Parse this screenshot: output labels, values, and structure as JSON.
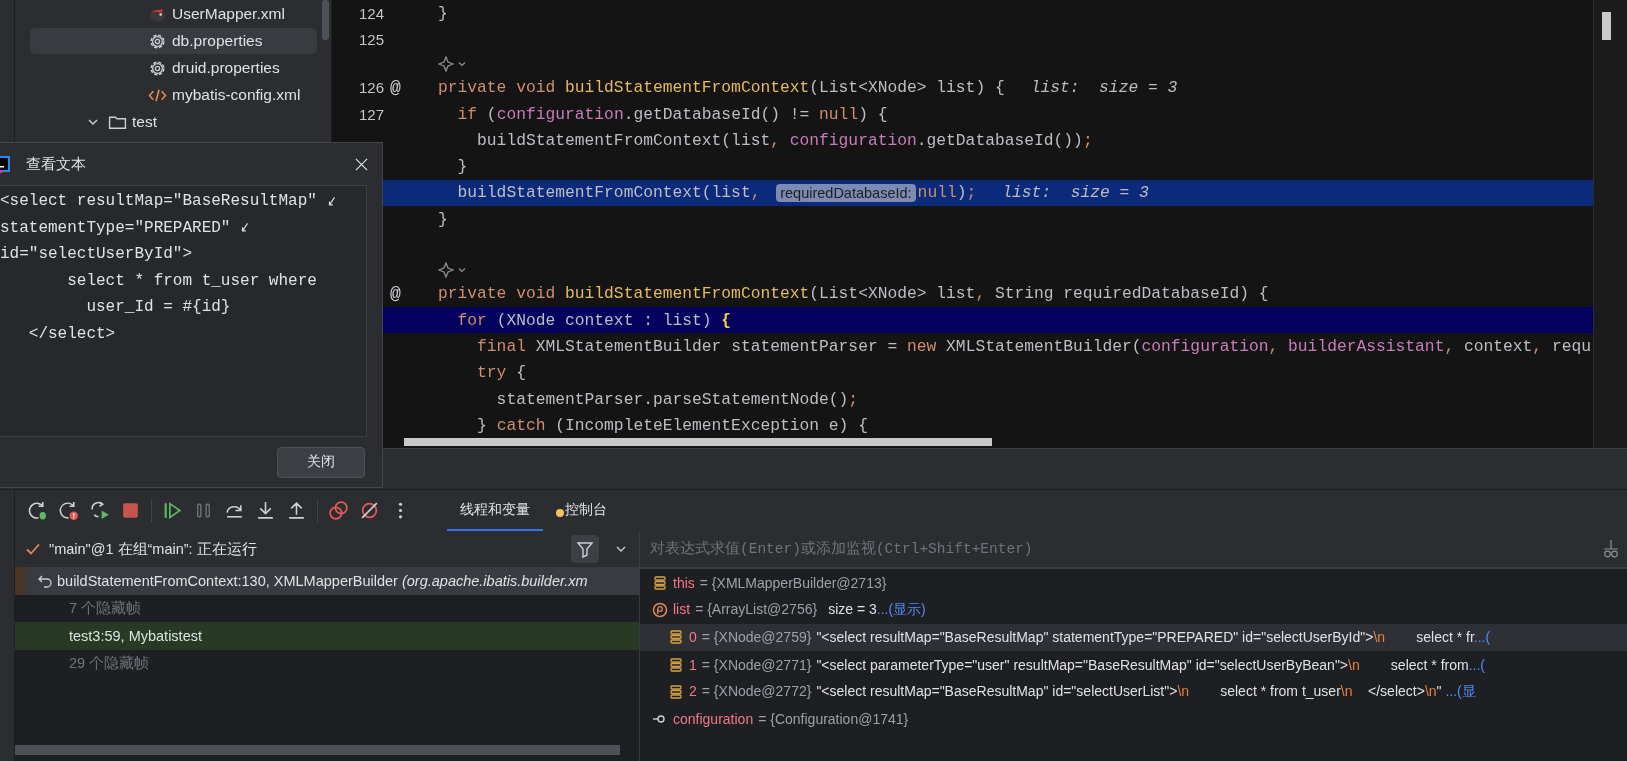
{
  "project_tree": {
    "files": [
      {
        "label": "UserMapper.xml",
        "kind": "mapper",
        "selected": false
      },
      {
        "label": "db.properties",
        "kind": "properties",
        "selected": true
      },
      {
        "label": "druid.properties",
        "kind": "properties",
        "selected": false
      },
      {
        "label": "mybatis-config.xml",
        "kind": "xml",
        "selected": false
      }
    ],
    "folders": [
      {
        "label": "test",
        "expanded": true,
        "selected": false
      }
    ]
  },
  "editor": {
    "lines": [
      {
        "kind": "code",
        "number": "124",
        "tokens": [
          {
            "kind": "plain",
            "text": "}"
          }
        ]
      },
      {
        "kind": "code",
        "number": "125"
      },
      {
        "kind": "inlay"
      },
      {
        "kind": "code",
        "number": "126",
        "gutter": "@",
        "tokens": [
          {
            "kind": "keyword",
            "text": "private void "
          },
          {
            "kind": "method",
            "text": "buildStatementFromContext"
          },
          {
            "kind": "plain",
            "text": "(List<XNode> list) {"
          },
          {
            "kind": "value",
            "text": "list:  size = 3"
          }
        ]
      },
      {
        "kind": "code",
        "number": "127",
        "tokens": [
          {
            "kind": "keyword",
            "text": "  if "
          },
          {
            "kind": "plain",
            "text": "("
          },
          {
            "kind": "field",
            "text": "configuration"
          },
          {
            "kind": "plain",
            "text": ".getDatabaseId() != "
          },
          {
            "kind": "keyword",
            "text": "null"
          },
          {
            "kind": "plain",
            "text": ") {"
          }
        ]
      },
      {
        "kind": "code",
        "tokens": [
          {
            "kind": "plain",
            "text": "    buildStatementFromContext(list"
          },
          {
            "kind": "punct",
            "text": ", "
          },
          {
            "kind": "field",
            "text": "configuration"
          },
          {
            "kind": "plain",
            "text": ".getDatabaseId())"
          },
          {
            "kind": "punct",
            "text": ";"
          }
        ]
      },
      {
        "kind": "code",
        "tokens": [
          {
            "kind": "plain",
            "text": "  }"
          }
        ]
      },
      {
        "kind": "frame_line",
        "tokens": [
          {
            "kind": "plain",
            "text": "  buildStatementFromContext(list"
          },
          {
            "kind": "punct",
            "text": ", "
          },
          {
            "kind": "param_hint",
            "text": "requiredDatabaseId:"
          },
          {
            "kind": "keyword",
            "text": "null"
          },
          {
            "kind": "plain",
            "text": ")"
          },
          {
            "kind": "punct",
            "text": ";"
          },
          {
            "kind": "value",
            "text": "list:  size = 3"
          }
        ]
      },
      {
        "kind": "code",
        "tokens": [
          {
            "kind": "plain",
            "text": "}"
          }
        ]
      },
      {
        "kind": "code"
      },
      {
        "kind": "inlay"
      },
      {
        "kind": "code",
        "gutter": "@",
        "tokens": [
          {
            "kind": "keyword",
            "text": "private void "
          },
          {
            "kind": "method",
            "text": "buildStatementFromContext"
          },
          {
            "kind": "plain",
            "text": "(List<XNode> list"
          },
          {
            "kind": "punct",
            "text": ", "
          },
          {
            "kind": "plain",
            "text": "String requiredDatabaseId) {"
          }
        ]
      },
      {
        "kind": "current_line",
        "tokens": [
          {
            "kind": "keyword",
            "text": "  for "
          },
          {
            "kind": "plain",
            "text": "(XNode context : list) "
          },
          {
            "kind": "match",
            "text": "{"
          }
        ]
      },
      {
        "kind": "code",
        "tokens": [
          {
            "kind": "keyword",
            "text": "    final "
          },
          {
            "kind": "plain",
            "text": "XMLStatementBuilder statementParser = "
          },
          {
            "kind": "keyword",
            "text": "new "
          },
          {
            "kind": "plain",
            "text": "XMLStatementBuilder("
          },
          {
            "kind": "field",
            "text": "configuration"
          },
          {
            "kind": "punct",
            "text": ", "
          },
          {
            "kind": "field",
            "text": "builderAssistant"
          },
          {
            "kind": "punct",
            "text": ", "
          },
          {
            "kind": "plain",
            "text": "context"
          },
          {
            "kind": "punct",
            "text": ", "
          },
          {
            "kind": "plain",
            "text": "requ"
          }
        ]
      },
      {
        "kind": "code",
        "tokens": [
          {
            "kind": "keyword",
            "text": "    try "
          },
          {
            "kind": "plain",
            "text": "{"
          }
        ]
      },
      {
        "kind": "code",
        "tokens": [
          {
            "kind": "plain",
            "text": "      statementParser.parseStatementNode()"
          },
          {
            "kind": "punct",
            "text": ";"
          }
        ]
      },
      {
        "kind": "code",
        "tokens": [
          {
            "kind": "plain",
            "text": "    } "
          },
          {
            "kind": "keyword",
            "text": "catch "
          },
          {
            "kind": "plain",
            "text": "(IncompleteElementException e) {"
          }
        ]
      }
    ]
  },
  "dialog": {
    "title": "查看文本",
    "lines": [
      {
        "text": "<select resultMap=\"BaseResultMap\"",
        "wrapped": true
      },
      {
        "text": "statementType=\"PREPARED\"",
        "wrapped": true
      },
      {
        "text": "id=\"selectUserById\">",
        "wrapped": false
      },
      {
        "text": "       select * from t_user where",
        "wrapped": false
      },
      {
        "text": "         user_Id = #{id}",
        "wrapped": false
      },
      {
        "text": "   </select>",
        "wrapped": false
      }
    ],
    "close_button": "关闭"
  },
  "debugger": {
    "tabs": [
      {
        "label": "线程和变量",
        "selected": true
      },
      {
        "label": "控制台",
        "selected": false
      }
    ],
    "thread": "\"main\"@1 在组“main”: 正在运行",
    "frames": [
      {
        "kind": "frame",
        "selected": true,
        "text": "buildStatementFromContext:130, XMLMapperBuilder *(org.apache.ibatis.builder.xm*"
      },
      {
        "kind": "hidden",
        "selected": false,
        "text": "7 个隐藏帧"
      },
      {
        "kind": "user_frame",
        "selected": false,
        "text": "test3:59, Mybatistest"
      },
      {
        "kind": "hidden",
        "selected": false,
        "text": "29 个隐藏帧"
      }
    ],
    "evaluate": {
      "placeholder": "对表达式求值(Enter)或添加监视(Ctrl+Shift+Enter)"
    },
    "variables": [
      {
        "kind": "field",
        "selected": false,
        "name": "this",
        "value": "= {XMLMapperBuilder@2713}"
      },
      {
        "kind": "parameter",
        "selected": false,
        "name": "list",
        "value": "= {ArrayList@2756}",
        "detail": "size = 3",
        "link": "...(显示)",
        "children": [
          {
            "kind": "element",
            "selected": true,
            "name": "0",
            "value": "= {XNode@2759}",
            "segments": [
              {
                "kind": "string",
                "text": "\"<select resultMap=\"BaseResultMap\" statementType=\"PREPARED\" id=\"selectUserById\">"
              },
              {
                "kind": "escape",
                "text": "\\n"
              },
              {
                "kind": "string",
                "text": "        select * fr"
              }
            ],
            "link": "...("
          },
          {
            "kind": "element",
            "selected": false,
            "name": "1",
            "value": "= {XNode@2771}",
            "segments": [
              {
                "kind": "string",
                "text": "\"<select parameterType=\"user\" resultMap=\"BaseResultMap\" id=\"selectUserByBean\">"
              },
              {
                "kind": "escape",
                "text": "\\n"
              },
              {
                "kind": "string",
                "text": "        select * from"
              }
            ],
            "link": "...("
          },
          {
            "kind": "element",
            "selected": false,
            "name": "2",
            "value": "= {XNode@2772}",
            "segments": [
              {
                "kind": "string",
                "text": "\"<select resultMap=\"BaseResultMap\" id=\"selectUserList\">"
              },
              {
                "kind": "escape",
                "text": "\\n"
              },
              {
                "kind": "string",
                "text": "        select * from t_user"
              },
              {
                "kind": "escape",
                "text": "\\n"
              },
              {
                "kind": "string",
                "text": "    </select>"
              },
              {
                "kind": "escape",
                "text": "\\n"
              },
              {
                "kind": "string",
                "text": "\""
              }
            ],
            "link": " ...(显"
          }
        ]
      },
      {
        "kind": "static",
        "selected": false,
        "name": "configuration",
        "value": "= {Configuration@1741}"
      }
    ]
  }
}
